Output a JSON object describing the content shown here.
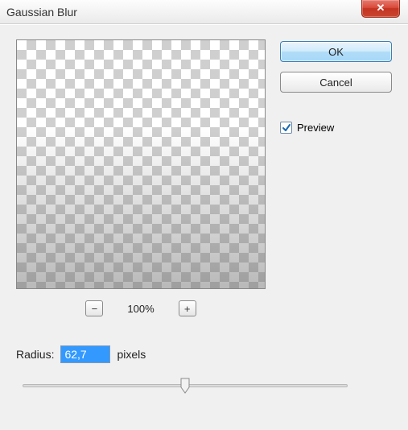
{
  "title": "Gaussian Blur",
  "close_glyph": "✕",
  "buttons": {
    "ok": "OK",
    "cancel": "Cancel"
  },
  "preview_checkbox": {
    "label": "Preview",
    "checked": true
  },
  "zoom": {
    "level": "100%",
    "minus": "−",
    "plus": "+"
  },
  "radius": {
    "label": "Radius:",
    "value": "62,7",
    "unit": "pixels"
  }
}
